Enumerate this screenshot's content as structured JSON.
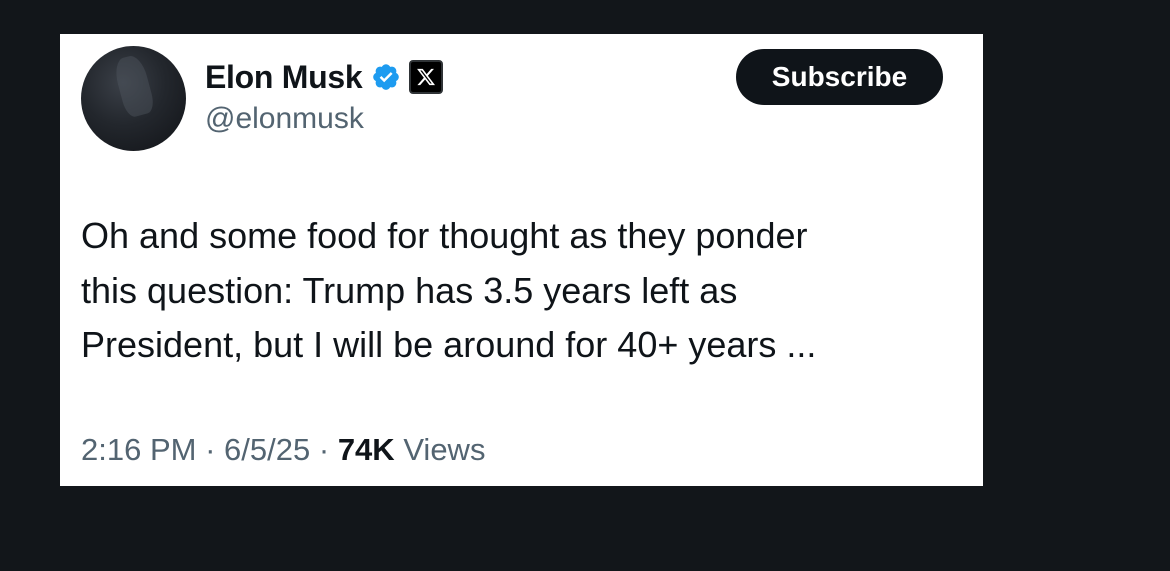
{
  "tweet": {
    "author": {
      "display_name": "Elon Musk",
      "handle": "@elonmusk",
      "verified_icon": "verified-badge-icon",
      "affiliation_icon": "x-logo-icon"
    },
    "subscribe_label": "Subscribe",
    "lines": [
      "Oh and some food for thought as they ponder",
      "this question: Trump has 3.5 years left as",
      "President, but I will be around for 40+ years ..."
    ],
    "time": "2:16 PM",
    "separator": "·",
    "date": "6/5/25",
    "views_count": "74K",
    "views_label": "Views"
  },
  "colors": {
    "background": "#12161a",
    "card": "#ffffff",
    "verified_blue": "#1d9bf0",
    "text_primary": "#0f1419",
    "text_secondary": "#536471"
  }
}
